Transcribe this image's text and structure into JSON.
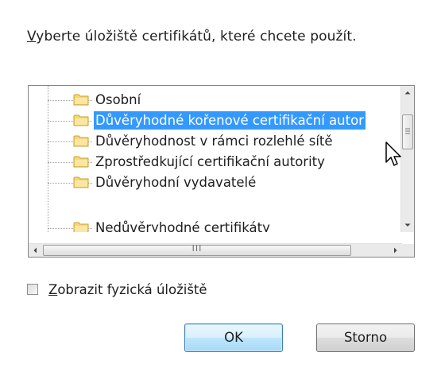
{
  "prompt": {
    "accel": "V",
    "rest": "yberte úložiště certifikátů, které chcete použít."
  },
  "tree": {
    "items": [
      {
        "label": "Osobní",
        "icon": "folder-icon"
      },
      {
        "label": "Důvěryhodné kořenové certifikační autor",
        "icon": "folder-icon",
        "selected": true
      },
      {
        "label": "Důvěryhodnost v rámci rozlehlé sítě",
        "icon": "folder-icon"
      },
      {
        "label": "Zprostředkující certifikační autority",
        "icon": "folder-icon"
      },
      {
        "label": "Důvěryhodní vydavatelé",
        "icon": "folder-icon"
      },
      {
        "label": "Nedůvěryhodné certifikáty",
        "icon": "folder-icon"
      }
    ],
    "hscroll_grip": "III"
  },
  "checkbox": {
    "accel": "Z",
    "rest": "obrazit fyzická úložiště",
    "checked": false
  },
  "buttons": {
    "ok_label": "OK",
    "cancel_label": "Storno"
  },
  "colors": {
    "selection": "#3399ff",
    "ok_border": "#3c7fb1"
  }
}
